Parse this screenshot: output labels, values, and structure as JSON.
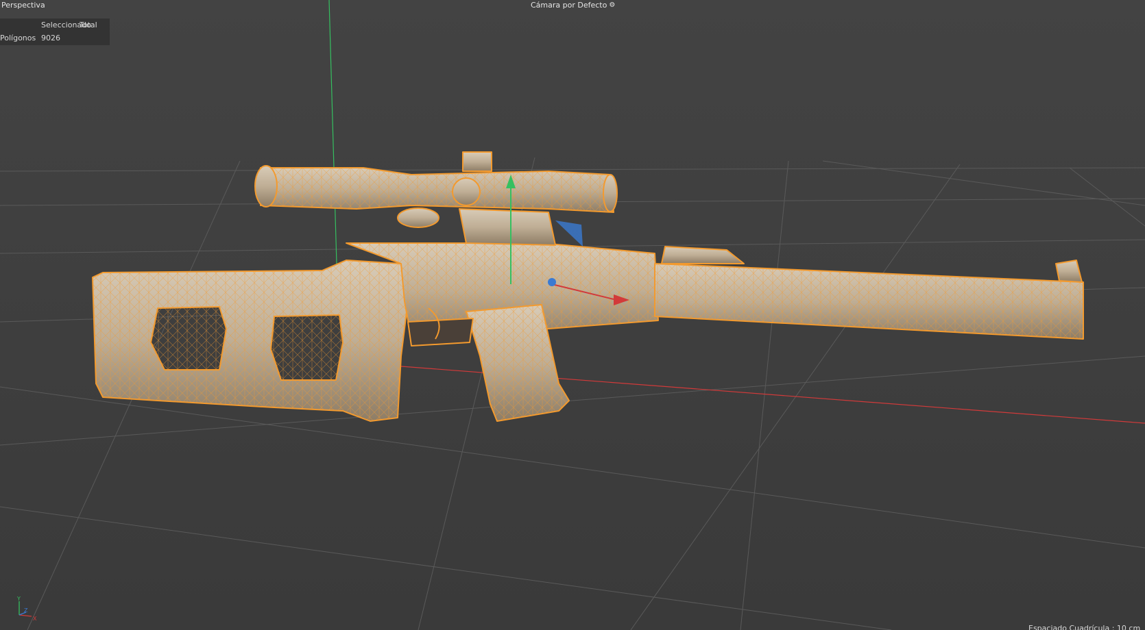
{
  "viewport": {
    "mode_label": "Perspectiva",
    "camera_label": "Cámara por Defecto",
    "camera_icon": "camera-options-icon"
  },
  "hud": {
    "headers": [
      "Seleccionado",
      "Total"
    ],
    "rows": [
      {
        "label": "Polígonos",
        "value": "9026"
      }
    ]
  },
  "axis_indicator": {
    "x": "X",
    "y": "Y",
    "z": "Z"
  },
  "footer": {
    "grid_spacing": "Espaciado Cuadrícula : 10 cm"
  },
  "colors": {
    "background": "#3f3f3f",
    "grid": "#5a5a5a",
    "axis_x": "#d23a3a",
    "axis_y": "#35c060",
    "axis_z": "#3a7ad2",
    "selection": "#f39a2e",
    "model_fill": "#c7b7a0"
  }
}
